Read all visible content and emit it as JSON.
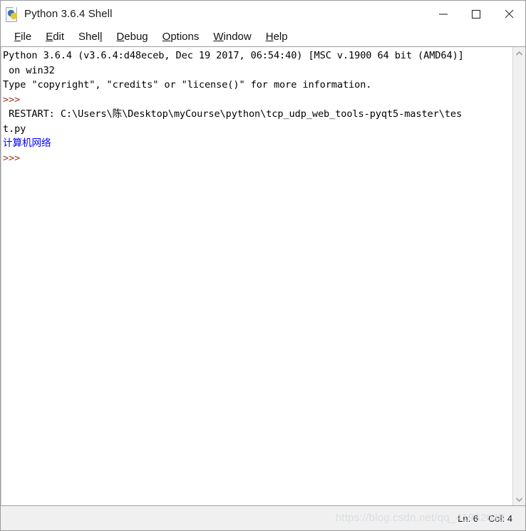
{
  "window": {
    "title": "Python 3.6.4 Shell",
    "icon": "python-file-icon",
    "controls": {
      "minimize": "minimize-icon",
      "maximize": "maximize-icon",
      "close": "close-icon"
    }
  },
  "menubar": {
    "items": [
      {
        "label": "File",
        "pre": "",
        "acc": "F",
        "post": "ile"
      },
      {
        "label": "Edit",
        "pre": "",
        "acc": "E",
        "post": "dit"
      },
      {
        "label": "Shell",
        "pre": "Shel",
        "acc": "l",
        "post": ""
      },
      {
        "label": "Debug",
        "pre": "",
        "acc": "D",
        "post": "ebug"
      },
      {
        "label": "Options",
        "pre": "",
        "acc": "O",
        "post": "ptions"
      },
      {
        "label": "Window",
        "pre": "",
        "acc": "W",
        "post": "indow"
      },
      {
        "label": "Help",
        "pre": "",
        "acc": "H",
        "post": "elp"
      }
    ]
  },
  "shell": {
    "lines": [
      {
        "text": "Python 3.6.4 (v3.6.4:d48eceb, Dec 19 2017, 06:54:40) [MSC v.1900 64 bit (AMD64)]",
        "color": "black"
      },
      {
        "text": " on win32",
        "color": "black"
      },
      {
        "text": "Type \"copyright\", \"credits\" or \"license()\" for more information.",
        "color": "black"
      },
      {
        "text": ">>> ",
        "color": "prompt"
      },
      {
        "text": " RESTART: C:\\Users\\陈\\Desktop\\myCourse\\python\\tcp_udp_web_tools-pyqt5-master\\tes",
        "color": "black"
      },
      {
        "text": "t.py",
        "color": "black"
      },
      {
        "text": "计算机网络",
        "color": "blue"
      },
      {
        "text": ">>> ",
        "color": "prompt"
      }
    ]
  },
  "scrollbar": {
    "up_arrow": "chevron-up-icon",
    "down_arrow": "chevron-down-icon"
  },
  "statusbar": {
    "line_label": "Ln: 6",
    "col_label": "Col: 4"
  },
  "watermark": {
    "text": "https://blog.csdn.net/qq_41932048"
  },
  "colors": {
    "prompt": "#9a3a26",
    "output": "#0000ff",
    "text": "#000000",
    "window_bg": "#ffffff",
    "statusbar_bg": "#f0f0f0",
    "scrollbar_bg": "#f0f0f0"
  }
}
